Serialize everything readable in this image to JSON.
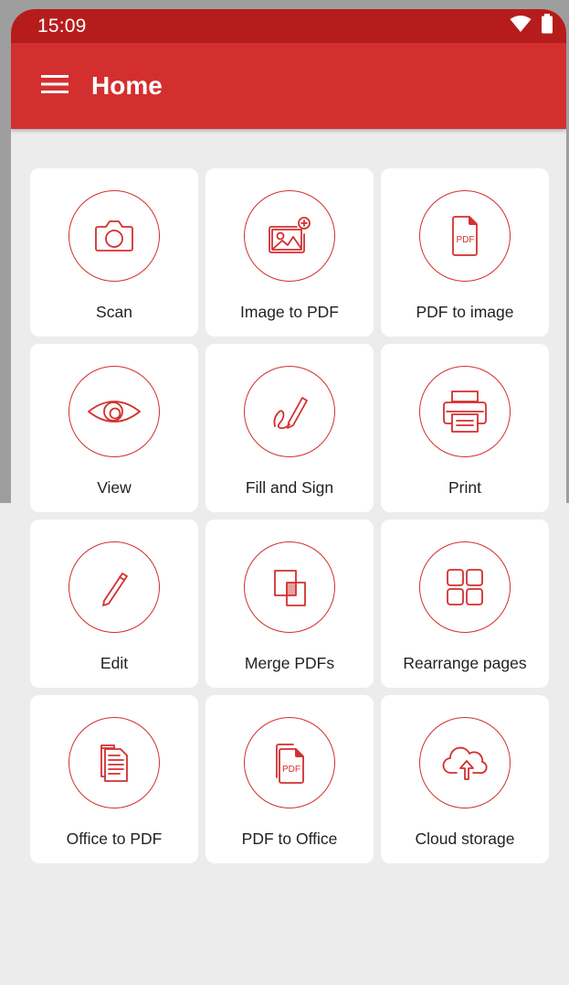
{
  "status_bar": {
    "time": "15:09",
    "icons": [
      "wifi-icon",
      "battery-icon"
    ]
  },
  "app_bar": {
    "title": "Home",
    "menu_icon": "hamburger-menu-icon"
  },
  "colors": {
    "primary": "#d32f2f",
    "primary_dark": "#b71c1c",
    "background": "#ececec",
    "tile": "#ffffff"
  },
  "tools": [
    {
      "label": "Scan",
      "icon": "camera-icon"
    },
    {
      "label": "Image to PDF",
      "icon": "image-add-icon"
    },
    {
      "label": "PDF to image",
      "icon": "pdf-file-icon"
    },
    {
      "label": "View",
      "icon": "eye-icon"
    },
    {
      "label": "Fill and Sign",
      "icon": "signature-pen-icon"
    },
    {
      "label": "Print",
      "icon": "printer-icon"
    },
    {
      "label": "Edit",
      "icon": "pencil-icon"
    },
    {
      "label": "Merge PDFs",
      "icon": "merge-squares-icon"
    },
    {
      "label": "Rearrange pages",
      "icon": "grid-pages-icon"
    },
    {
      "label": "Office to PDF",
      "icon": "documents-icon"
    },
    {
      "label": "PDF to Office",
      "icon": "pdf-stack-icon"
    },
    {
      "label": "Cloud storage",
      "icon": "cloud-upload-icon"
    }
  ],
  "pdf_badge": "PDF"
}
